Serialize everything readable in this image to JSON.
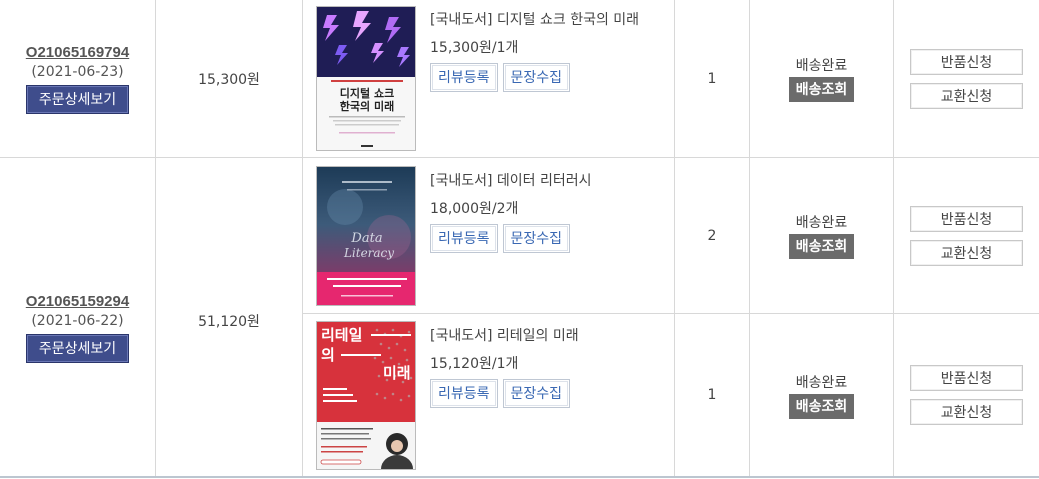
{
  "orders": [
    {
      "order_no": "O21065169794",
      "order_date": "(2021-06-23)",
      "detail_label": "주문상세보기",
      "total": "15,300원",
      "items": [
        {
          "title": "[국내도서] 디지털 쇼크 한국의 미래",
          "price": "15,300원/1개",
          "review_label": "리뷰등록",
          "quote_label": "문장수집",
          "qty": "1",
          "status": "배송완료",
          "track_label": "배송조회",
          "return_label": "반품신청",
          "exchange_label": "교환신청",
          "cover": {
            "main": "디지털 쇼크\n한국의 미래",
            "kind": "digital-shock"
          }
        }
      ]
    },
    {
      "order_no": "O21065159294",
      "order_date": "(2021-06-22)",
      "detail_label": "주문상세보기",
      "total": "51,120원",
      "items": [
        {
          "title": "[국내도서] 데이터 리터러시",
          "price": "18,000원/2개",
          "review_label": "리뷰등록",
          "quote_label": "문장수집",
          "qty": "2",
          "status": "배송완료",
          "track_label": "배송조회",
          "return_label": "반품신청",
          "exchange_label": "교환신청",
          "cover": {
            "main": "Data Literacy",
            "kind": "data-literacy"
          }
        },
        {
          "title": "[국내도서] 리테일의 미래",
          "price": "15,120원/1개",
          "review_label": "리뷰등록",
          "quote_label": "문장수집",
          "qty": "1",
          "status": "배송완료",
          "track_label": "배송조회",
          "return_label": "반품신청",
          "exchange_label": "교환신청",
          "cover": {
            "main": "리테일의 미래",
            "kind": "retail"
          }
        }
      ]
    }
  ],
  "colors": {
    "detail_button": "#3f4d8c",
    "track_button": "#6b6b6b",
    "link_blue": "#3a68b3",
    "grid": "#d8d8d8"
  }
}
